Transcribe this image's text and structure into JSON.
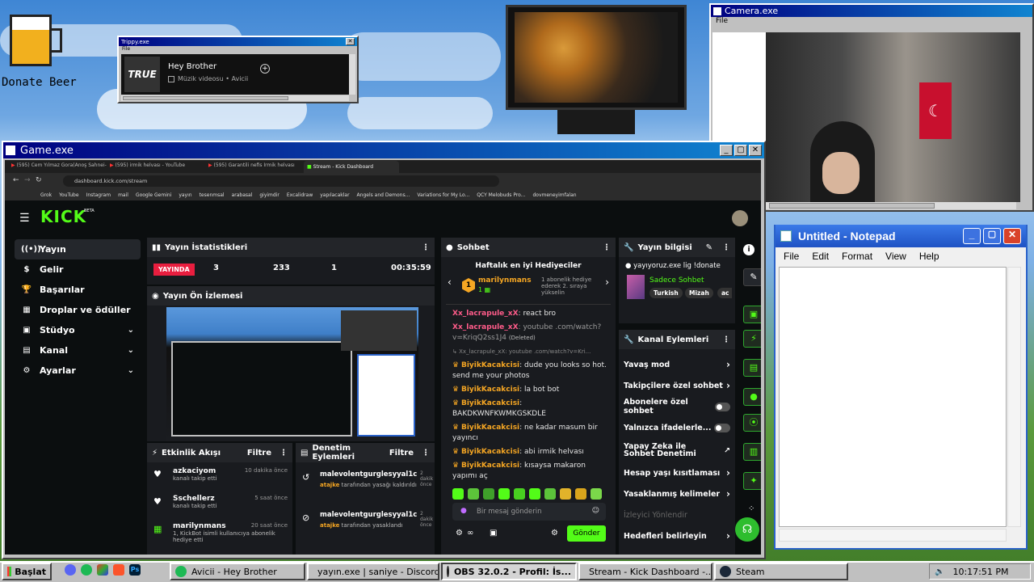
{
  "desktop": {
    "donate_label": "Donate Beer"
  },
  "trippy": {
    "title": "Trippy.exe",
    "menu": "File",
    "song": "Hey Brother",
    "sub": "Müzik videosu • Avicii",
    "art": "TRUE"
  },
  "camera": {
    "title": "Camera.exe",
    "menu": "File"
  },
  "notepad": {
    "title": "Untitled - Notepad",
    "menu": [
      "File",
      "Edit",
      "Format",
      "View",
      "Help"
    ]
  },
  "game": {
    "title": "Game.exe"
  },
  "browser": {
    "tabs": [
      "(595) Cem Yılmaz Gora(Anoş Sahnei-",
      "(595) irmik helvası - YouTube",
      "(595) Garantili nefis İrmik helvası",
      "Stream - Kick Dashboard"
    ],
    "url": "dashboard.kick.com/stream",
    "bookmarks": [
      "Grok",
      "YouTube",
      "Instagram",
      "mail",
      "Google Gemini",
      "yayın",
      "tesenmsal",
      "arabasal",
      "giyimdir",
      "Excalidraw",
      "yapılacaklar",
      "Angels and Demons...",
      "Variations for My Lo...",
      "QCY Melobuds Pro...",
      "dovmeneyimfalan"
    ]
  },
  "kick": {
    "logo": "KICK",
    "beta": "BETA",
    "nav": [
      {
        "label": "Yayın",
        "icon": "((•))"
      },
      {
        "label": "Gelir",
        "icon": "$"
      },
      {
        "label": "Başarılar",
        "icon": "🏆"
      },
      {
        "label": "Droplar ve ödüller",
        "icon": "▦"
      },
      {
        "label": "Stüdyo",
        "icon": "▣",
        "chev": "⌄"
      },
      {
        "label": "Kanal",
        "icon": "▤",
        "chev": "⌄"
      },
      {
        "label": "Ayarlar",
        "icon": "⚙",
        "chev": "⌄"
      }
    ],
    "stats": {
      "title": "Yayın İstatistikleri",
      "live": "YAYINDA",
      "values": [
        "3",
        "233",
        "1",
        "00:35:59"
      ]
    },
    "preview": {
      "title": "Yayın Ön İzlemesi"
    },
    "activity": {
      "title": "Etkinlik Akışı",
      "filter": "Filtre",
      "items": [
        {
          "user": "azkaciyom",
          "time": "10 dakika önce",
          "text": "kanalı takip etti"
        },
        {
          "user": "Sschellerz",
          "time": "5 saat önce",
          "text": "kanalı takip etti"
        },
        {
          "user": "marilynmans",
          "time": "20 saat önce",
          "text": "1, KickBot isimli kullanıcıya abonelik hediye etti"
        }
      ]
    },
    "moderation": {
      "title": "Denetim Eylemleri",
      "filter": "Filtre",
      "items": [
        {
          "user": "malevolentgurglesyyal1cm",
          "time": "2 dakika önce",
          "by": "atajke",
          "text": "tarafından yasağı kaldırıldı"
        },
        {
          "user": "malevolentgurglesyyal1cm",
          "time": "2 dakika önce",
          "by": "atajke",
          "text": "tarafından yasaklandı"
        }
      ]
    },
    "chat": {
      "title": "Sohbet",
      "gifter_title": "Haftalık en iyi Hediyeciler",
      "gifter_name": "marilynmans",
      "gifter_count": "1",
      "gifter_rank": "1",
      "gifter_note": "1 abonelik hediye ederek 2. sıraya yükselin",
      "messages": [
        {
          "user": "Xx_lacrapule_xX",
          "color": "#ff5c8a",
          "text": "react bro"
        },
        {
          "user": "Xx_lacrapule_xX",
          "color": "#ff5c8a",
          "text": "youtube .com/watch?v=KriqQ2ss1J4",
          "deleted": "(Deleted)"
        },
        {
          "user": "",
          "color": "#888",
          "text": "Xx_lacrapule_xX: youtube .com/watch?v=Kri..."
        },
        {
          "user": "BiyikKacakcisi",
          "color": "#f5a623",
          "text": "dude you looks so hot. send me your photos"
        },
        {
          "user": "BiyikKacakcisi",
          "color": "#f5a623",
          "text": "la bot bot"
        },
        {
          "user": "BiyikKacakcisi",
          "color": "#f5a623",
          "text": "BAKDKWNFKWMKGSKDLE"
        },
        {
          "user": "BiyikKacakcisi",
          "color": "#f5a623",
          "text": "ne kadar masum bir yayıncı"
        },
        {
          "user": "BiyikKacakcisi",
          "color": "#f5a623",
          "text": "abi irmik helvası"
        },
        {
          "user": "BiyikKacakcisi",
          "color": "#f5a623",
          "text": "kısaysa makaron yapımı aç"
        }
      ],
      "placeholder": "Bir mesaj gönderin",
      "send": "Gönder"
    },
    "info": {
      "title": "Yayın bilgisi",
      "stream_title": "yayıyoruz.exe lig !donate",
      "category": "Sadece Sohbet",
      "tags": [
        "Turkish",
        "Mizah",
        "ac"
      ]
    },
    "actions": {
      "title": "Kanal Eylemleri",
      "items": [
        {
          "label": "Yavaş mod",
          "ctl": "›"
        },
        {
          "label": "Takipçilere özel sohbet",
          "ctl": "›"
        },
        {
          "label": "Abonelere özel sohbet",
          "ctl": "toggle"
        },
        {
          "label": "Yalnızca ifadelerle...",
          "ctl": "toggle"
        },
        {
          "label": "Yapay Zeka ile Sohbet Denetimi",
          "ctl": "↗"
        },
        {
          "label": "Hesap yaşı kısıtlaması",
          "ctl": "›"
        },
        {
          "label": "Yasaklanmış kelimeler",
          "ctl": "›"
        },
        {
          "label": "İzleyici Yönlendir",
          "ctl": ""
        },
        {
          "label": "Hedefleri belirleyin",
          "ctl": "›"
        }
      ]
    }
  },
  "taskbar": {
    "start": "Başlat",
    "items": [
      "Avicii - Hey Brother",
      "yayın.exe | saniye - Discord",
      "OBS 32.0.2 - Profil: İs...",
      "Stream - Kick Dashboard -...",
      "Steam"
    ],
    "clock": "10:17:51 PM"
  },
  "colors": {
    "kick_green": "#53fc18",
    "win_title": "#000080",
    "panel_bg": "#191b1f"
  }
}
